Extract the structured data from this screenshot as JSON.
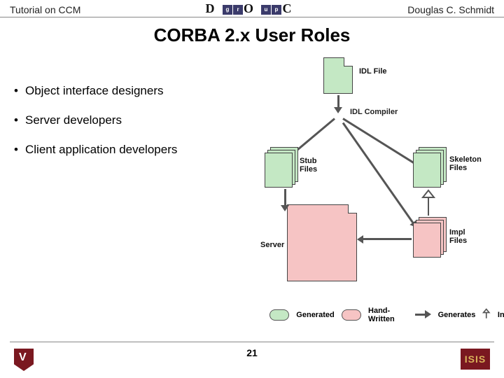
{
  "header": {
    "left": "Tutorial on CCM",
    "right": "Douglas C. Schmidt",
    "logo_big": [
      "D",
      "O",
      "C"
    ],
    "logo_small": [
      "g",
      "r",
      "u",
      "p"
    ]
  },
  "title": "CORBA 2.x User Roles",
  "bullets": [
    "Object interface designers",
    "Server developers",
    "Client application developers"
  ],
  "diagram": {
    "idl_file": "IDL File",
    "idl_compiler": "IDL Compiler",
    "stub_files": "Stub\nFiles",
    "skeleton_files": "Skeleton\nFiles",
    "impl_files": "Impl\nFiles",
    "server": "Server"
  },
  "legend": {
    "generated": "Generated",
    "hand_written": "Hand-Written",
    "generates": "Generates",
    "inherits": "Inherits"
  },
  "page_number": "21",
  "footer": {
    "right_logo_text": "ISIS"
  }
}
